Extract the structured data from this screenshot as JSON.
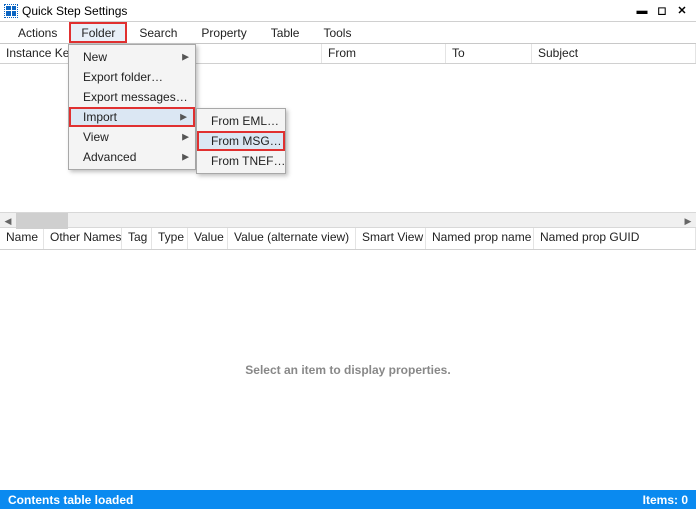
{
  "title": "Quick Step Settings",
  "menubar": {
    "actions": "Actions",
    "folder": "Folder",
    "search": "Search",
    "property": "Property",
    "table": "Table",
    "tools": "Tools"
  },
  "top_columns": {
    "instance_key": "Instance Ke",
    "from": "From",
    "to": "To",
    "subject": "Subject"
  },
  "folder_menu": {
    "new": "New",
    "export_folder": "Export folder…",
    "export_messages": "Export messages…",
    "import": "Import",
    "view": "View",
    "advanced": "Advanced"
  },
  "import_menu": {
    "from_eml": "From EML…",
    "from_msg": "From MSG…",
    "from_tnef": "From TNEF…"
  },
  "bottom_columns": {
    "name": "Name",
    "other_names": "Other Names",
    "tag": "Tag",
    "type": "Type",
    "value": "Value",
    "value_alt": "Value (alternate view)",
    "smart_view": "Smart View",
    "named_prop_name": "Named prop name",
    "named_prop_guid": "Named prop GUID"
  },
  "placeholder": "Select an item to display properties.",
  "status": {
    "text": "Contents table loaded",
    "items_label": "Items: 0"
  }
}
